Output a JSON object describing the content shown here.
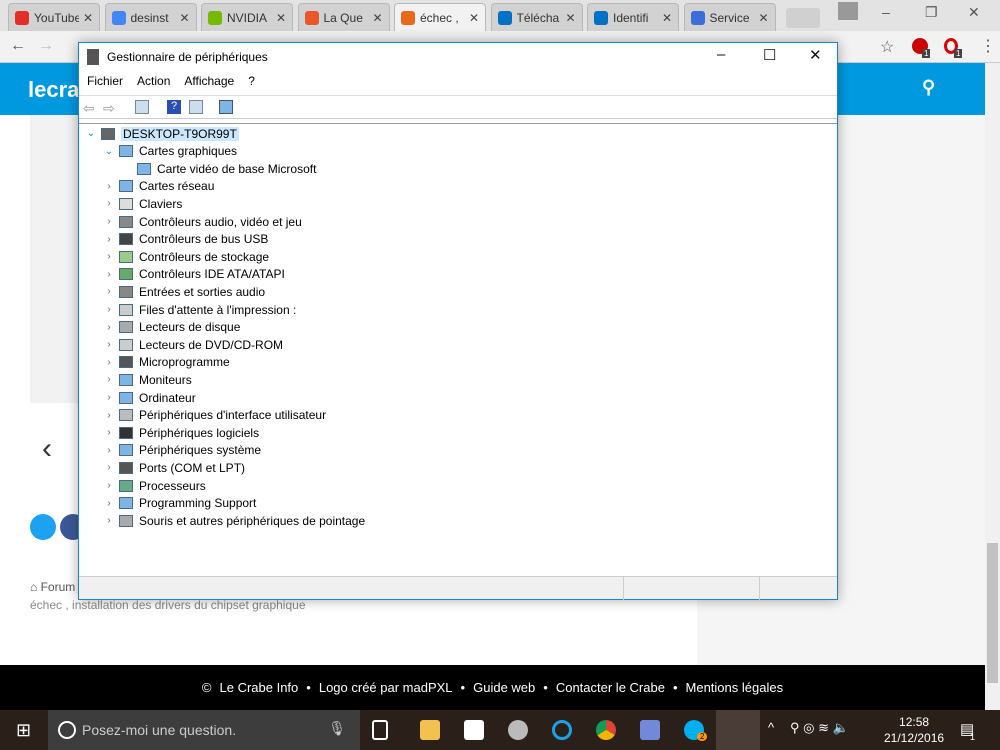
{
  "browser": {
    "tabs": [
      {
        "label": "YouTube",
        "color": "#e52d27"
      },
      {
        "label": "desinst",
        "color": "#4285f4"
      },
      {
        "label": "NVIDIA",
        "color": "#76b900"
      },
      {
        "label": "La Que",
        "color": "#e8562a"
      },
      {
        "label": "échec ,",
        "color": "#e86a1a"
      },
      {
        "label": "Télécha",
        "color": "#0071c5"
      },
      {
        "label": "Identifi",
        "color": "#0071c5"
      },
      {
        "label": "Service",
        "color": "#3b6ed9"
      }
    ],
    "extensions": {
      "abp_badge": "1",
      "opera_badge": "1"
    }
  },
  "site": {
    "logo": "lecra",
    "breadcrumb": "Forum",
    "subtitle": "échec , installation des drivers du chipset graphique",
    "footer": [
      "Le Crabe Info",
      "Logo créé par madPXL",
      "Guide web",
      "Contacter le Crabe",
      "Mentions légales"
    ]
  },
  "dialog": {
    "title": "Gestionnaire de périphériques",
    "menu": [
      "Fichier",
      "Action",
      "Affichage",
      "?"
    ],
    "root": "DESKTOP-T9OR99T",
    "expanded": {
      "label": "Cartes graphiques",
      "children": [
        "Carte vidéo de base Microsoft"
      ]
    },
    "categories": [
      "Cartes réseau",
      "Claviers",
      "Contrôleurs audio, vidéo et jeu",
      "Contrôleurs de bus USB",
      "Contrôleurs de stockage",
      "Contrôleurs IDE ATA/ATAPI",
      "Entrées et sorties audio",
      "Files d'attente à l'impression :",
      "Lecteurs de disque",
      "Lecteurs de DVD/CD-ROM",
      "Microprogramme",
      "Moniteurs",
      "Ordinateur",
      "Périphériques d'interface utilisateur",
      "Périphériques logiciels",
      "Périphériques système",
      "Ports (COM et LPT)",
      "Processeurs",
      "Programming Support",
      "Souris et autres périphériques de pointage"
    ]
  },
  "taskbar": {
    "search_placeholder": "Posez-moi une question.",
    "time": "12:58",
    "date": "21/12/2016",
    "skype_badge": "2",
    "notif_badge": "1"
  }
}
